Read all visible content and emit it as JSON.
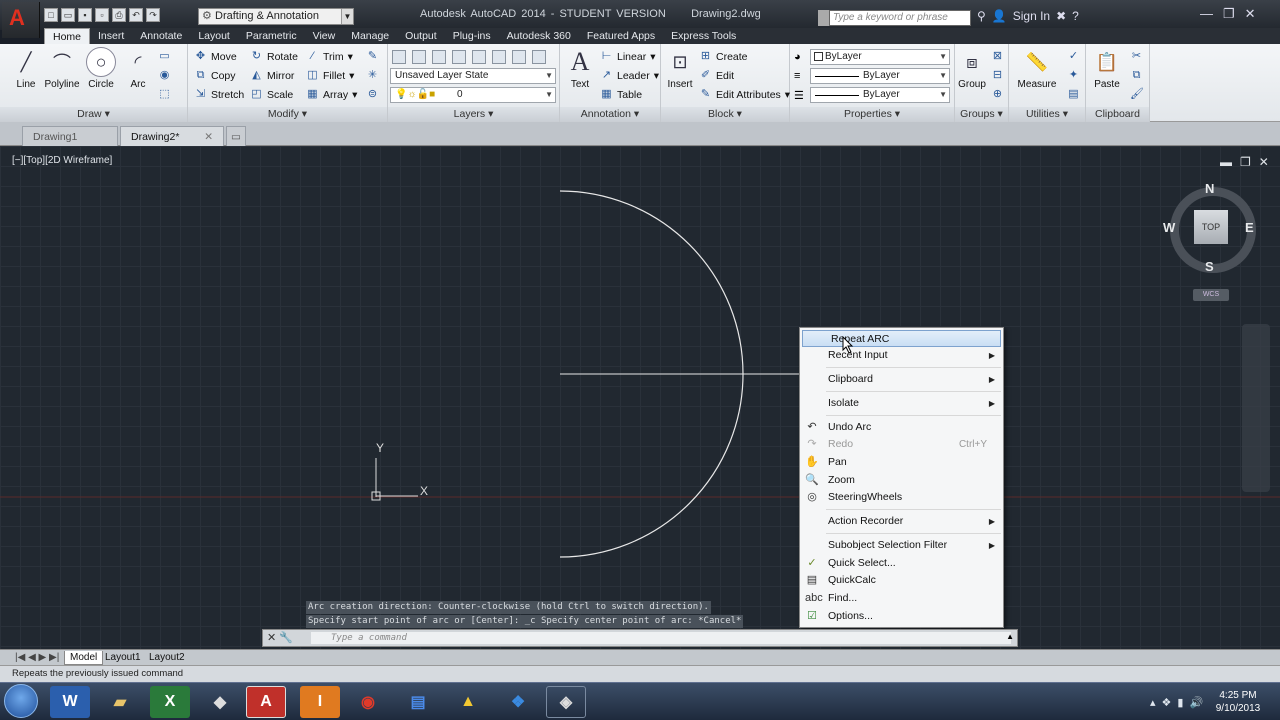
{
  "app": {
    "title": "Autodesk AutoCAD 2014 - STUDENT VERSION",
    "drawing": "Drawing2.dwg",
    "workspace": "Drafting & Annotation",
    "search_placeholder": "Type a keyword or phrase",
    "sign_in": "Sign In"
  },
  "ribbon_tabs": [
    "Home",
    "Insert",
    "Annotate",
    "Layout",
    "Parametric",
    "View",
    "Manage",
    "Output",
    "Plug-ins",
    "Autodesk 360",
    "Featured Apps",
    "Express Tools"
  ],
  "panels": {
    "draw": {
      "title": "Draw",
      "line": "Line",
      "polyline": "Polyline",
      "circle": "Circle",
      "arc": "Arc"
    },
    "modify": {
      "title": "Modify",
      "move": "Move",
      "rotate": "Rotate",
      "trim": "Trim",
      "copy": "Copy",
      "mirror": "Mirror",
      "fillet": "Fillet",
      "stretch": "Stretch",
      "scale": "Scale",
      "array": "Array"
    },
    "layers": {
      "title": "Layers",
      "layer_state": "Unsaved Layer State",
      "layer": "0"
    },
    "annotation": {
      "title": "Annotation",
      "text": "Text",
      "linear": "Linear",
      "leader": "Leader",
      "table": "Table"
    },
    "block": {
      "title": "Block",
      "insert": "Insert",
      "create": "Create",
      "edit": "Edit",
      "edit_attributes": "Edit Attributes"
    },
    "properties": {
      "title": "Properties",
      "color": "ByLayer",
      "linetype": "ByLayer",
      "lineweight": "ByLayer"
    },
    "groups": {
      "title": "Groups",
      "group": "Group"
    },
    "utilities": {
      "title": "Utilities",
      "measure": "Measure"
    },
    "clipboard": {
      "title": "Clipboard",
      "paste": "Paste"
    }
  },
  "doc_tabs": [
    "Drawing1",
    "Drawing2*"
  ],
  "viewport": {
    "label": "[−][Top][2D Wireframe]"
  },
  "viewcube": {
    "top": "TOP",
    "n": "N",
    "s": "S",
    "e": "E",
    "w": "W",
    "wcs": "WCS"
  },
  "ucs": {
    "x": "X",
    "y": "Y"
  },
  "context_menu": [
    {
      "label": "Repeat ARC",
      "icon": "",
      "submenu": false,
      "hover": true
    },
    {
      "label": "Recent Input",
      "icon": "",
      "submenu": true
    },
    {
      "label": "Clipboard",
      "icon": "",
      "submenu": true
    },
    {
      "label": "Isolate",
      "icon": "",
      "submenu": true
    },
    {
      "label": "Undo Arc",
      "icon": "undo-icon",
      "submenu": false
    },
    {
      "label": "Redo",
      "icon": "redo-icon",
      "submenu": false,
      "disabled": true,
      "shortcut": "Ctrl+Y"
    },
    {
      "label": "Pan",
      "icon": "pan-icon",
      "submenu": false
    },
    {
      "label": "Zoom",
      "icon": "zoom-icon",
      "submenu": false
    },
    {
      "label": "SteeringWheels",
      "icon": "steeringwheel-icon",
      "submenu": false
    },
    {
      "label": "Action Recorder",
      "icon": "",
      "submenu": true
    },
    {
      "label": "Subobject Selection Filter",
      "icon": "",
      "submenu": true
    },
    {
      "label": "Quick Select...",
      "icon": "quickselect-icon",
      "submenu": false
    },
    {
      "label": "QuickCalc",
      "icon": "calculator-icon",
      "submenu": false
    },
    {
      "label": "Find...",
      "icon": "find-icon",
      "submenu": false
    },
    {
      "label": "Options...",
      "icon": "options-icon",
      "submenu": false
    }
  ],
  "command": {
    "history": [
      "Arc creation direction: Counter-clockwise (hold Ctrl to switch direction).",
      "Specify start point of arc or [Center]: _c Specify center point of arc: *Cancel*"
    ],
    "placeholder": "Type a command"
  },
  "layout_tabs": [
    "Model",
    "Layout1",
    "Layout2"
  ],
  "status_text": "Repeats the previously issued command",
  "clock": {
    "time": "4:25 PM",
    "date": "9/10/2013"
  }
}
